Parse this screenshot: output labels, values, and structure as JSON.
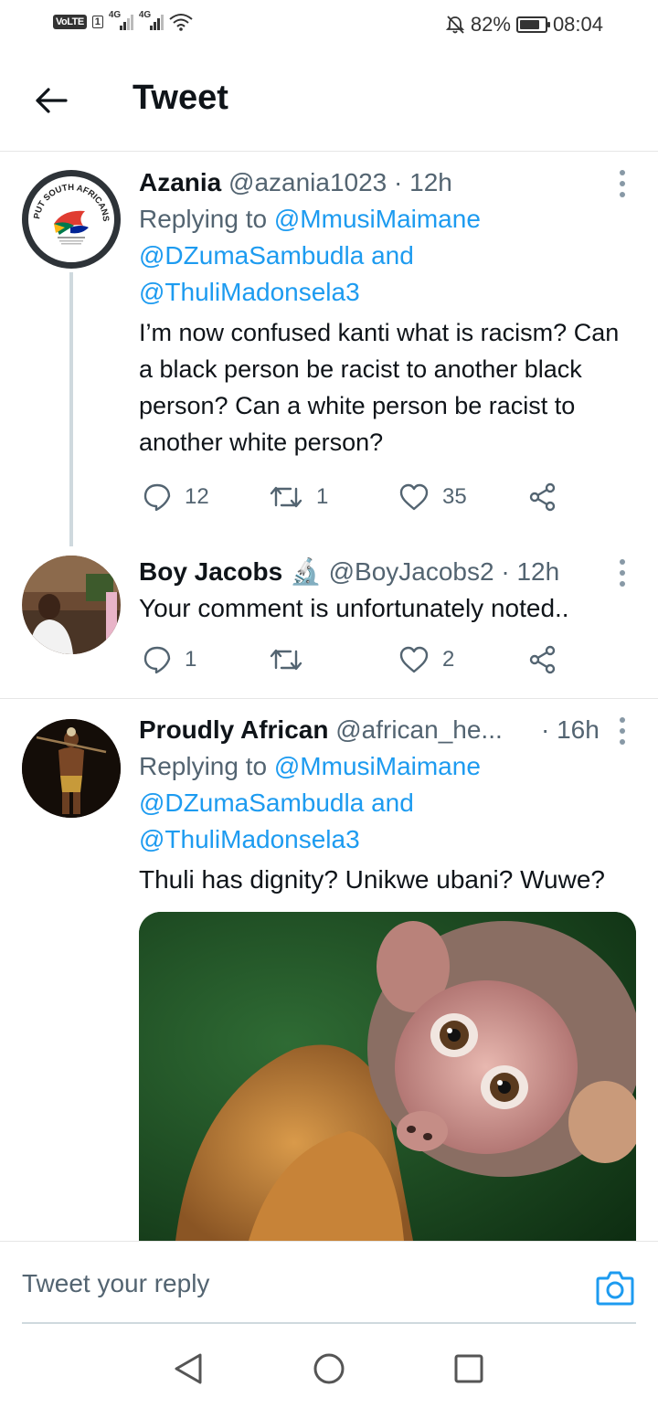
{
  "status_bar": {
    "volte": "VoLTE",
    "sim": "1",
    "net1": "4G",
    "net2": "4G",
    "battery_percent": "82%",
    "battery_level": 0.82,
    "time": "08:04"
  },
  "header": {
    "title": "Tweet"
  },
  "tweets": [
    {
      "name": "Azania",
      "handle": "@azania1023",
      "time": "· 12h",
      "replying_prefix": "Replying to",
      "mention1": "@MmusiMaimane",
      "mention2": "@DZumaSambudla",
      "and": "and",
      "mention3": "@ThuliMadonsela3",
      "text": "I’m now confused kanti what is racism? Can a black person be racist to another black person? Can a white person be racist to another white person?",
      "avatar_text": "PUT SOUTH AFRICANS FIRST",
      "replies": "12",
      "retweets": "1",
      "likes": "35"
    },
    {
      "name": "Boy Jacobs",
      "name_emoji": "🔬",
      "handle": "@BoyJacobs2",
      "time": "· 12h",
      "text": "Your comment is unfortunately noted..",
      "replies": "1",
      "retweets": "",
      "likes": "2"
    },
    {
      "name": "Proudly African",
      "handle": "@african_he...",
      "time": "· 16h",
      "replying_prefix": "Replying to",
      "mention1": "@MmusiMaimane",
      "mention2": "@DZumaSambudla",
      "and": "and",
      "mention3": "@ThuliMadonsela3",
      "text": "Thuli has dignity? Unikwe ubani? Wuwe?"
    }
  ],
  "reply_bar": {
    "placeholder": "Tweet your reply"
  },
  "colors": {
    "accent": "#1d9bf0",
    "text": "#0f1419",
    "secondary": "#536471",
    "divider": "#e6e6e6"
  },
  "icons": [
    "back-arrow-icon",
    "more-vertical-icon",
    "reply-icon",
    "retweet-icon",
    "like-icon",
    "share-icon",
    "camera-icon",
    "nav-back-icon",
    "nav-home-icon",
    "nav-recents-icon"
  ]
}
